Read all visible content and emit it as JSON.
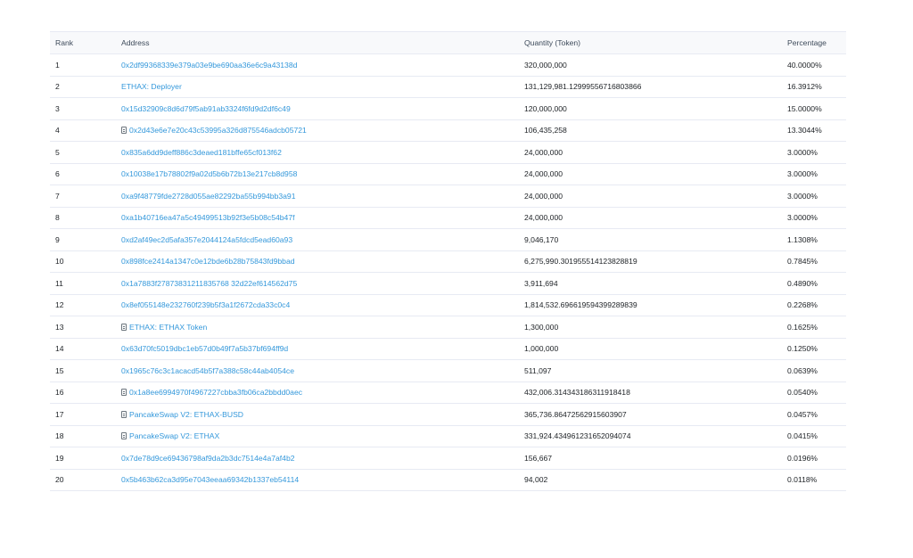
{
  "table": {
    "headers": {
      "rank": "Rank",
      "address": "Address",
      "quantity": "Quantity (Token)",
      "percentage": "Percentage"
    },
    "rows": [
      {
        "rank": "1",
        "address": "0x2df99368339e379a03e9be690aa36e6c9a43138d",
        "contract": false,
        "quantity": "320,000,000",
        "percentage": "40.0000%"
      },
      {
        "rank": "2",
        "address": "ETHAX: Deployer",
        "contract": false,
        "quantity": "131,129,981.12999556716803866",
        "percentage": "16.3912%"
      },
      {
        "rank": "3",
        "address": "0x15d32909c8d6d79f5ab91ab3324f6fd9d2df6c49",
        "contract": false,
        "quantity": "120,000,000",
        "percentage": "15.0000%"
      },
      {
        "rank": "4",
        "address": "0x2d43e6e7e20c43c53995a326d875546adcb05721",
        "contract": true,
        "quantity": "106,435,258",
        "percentage": "13.3044%"
      },
      {
        "rank": "5",
        "address": "0x835a6dd9deff886c3deaed181bffe65cf013f62",
        "contract": false,
        "quantity": "24,000,000",
        "percentage": "3.0000%"
      },
      {
        "rank": "6",
        "address": "0x10038e17b78802f9a02d5b6b72b13e217cb8d958",
        "contract": false,
        "quantity": "24,000,000",
        "percentage": "3.0000%"
      },
      {
        "rank": "7",
        "address": "0xa9f48779fde2728d055ae82292ba55b994bb3a91",
        "contract": false,
        "quantity": "24,000,000",
        "percentage": "3.0000%"
      },
      {
        "rank": "8",
        "address": "0xa1b40716ea47a5c49499513b92f3e5b08c54b47f",
        "contract": false,
        "quantity": "24,000,000",
        "percentage": "3.0000%"
      },
      {
        "rank": "9",
        "address": "0xd2af49ec2d5afa357e2044124a5fdcd5ead60a93",
        "contract": false,
        "quantity": "9,046,170",
        "percentage": "1.1308%"
      },
      {
        "rank": "10",
        "address": "0x898fce2414a1347c0e12bde6b28b75843fd9bbad",
        "contract": false,
        "quantity": "6,275,990.301955514123828819",
        "percentage": "0.7845%"
      },
      {
        "rank": "11",
        "address": "0x1a7883f27873831211835768 32d22ef614562d75",
        "contract": false,
        "quantity": "3,911,694",
        "percentage": "0.4890%"
      },
      {
        "rank": "12",
        "address": "0x8ef055148e232760f239b5f3a1f2672cda33c0c4",
        "contract": false,
        "quantity": "1,814,532.696619594399289839",
        "percentage": "0.2268%"
      },
      {
        "rank": "13",
        "address": "ETHAX: ETHAX Token",
        "contract": true,
        "quantity": "1,300,000",
        "percentage": "0.1625%"
      },
      {
        "rank": "14",
        "address": "0x63d70fc5019dbc1eb57d0b49f7a5b37bf694ff9d",
        "contract": false,
        "quantity": "1,000,000",
        "percentage": "0.1250%"
      },
      {
        "rank": "15",
        "address": "0x1965c76c3c1acacd54b5f7a388c58c44ab4054ce",
        "contract": false,
        "quantity": "511,097",
        "percentage": "0.0639%"
      },
      {
        "rank": "16",
        "address": "0x1a8ee6994970f4967227cbba3fb06ca2bbdd0aec",
        "contract": true,
        "quantity": "432,006.314343186311918418",
        "percentage": "0.0540%"
      },
      {
        "rank": "17",
        "address": "PancakeSwap V2: ETHAX-BUSD",
        "contract": true,
        "quantity": "365,736.86472562915603907",
        "percentage": "0.0457%"
      },
      {
        "rank": "18",
        "address": "PancakeSwap V2: ETHAX",
        "contract": true,
        "quantity": "331,924.434961231652094074",
        "percentage": "0.0415%"
      },
      {
        "rank": "19",
        "address": "0x7de78d9ce69436798af9da2b3dc7514e4a7af4b2",
        "contract": false,
        "quantity": "156,667",
        "percentage": "0.0196%"
      },
      {
        "rank": "20",
        "address": "0x5b463b62ca3d95e7043eeaa69342b1337eb54114",
        "contract": false,
        "quantity": "94,002",
        "percentage": "0.0118%"
      }
    ]
  },
  "icons": {
    "contract": "contract-icon"
  },
  "colors": {
    "link": "#3498db",
    "header_bg": "#f8f9fb",
    "border": "#e7eaf3",
    "text": "#212529"
  }
}
